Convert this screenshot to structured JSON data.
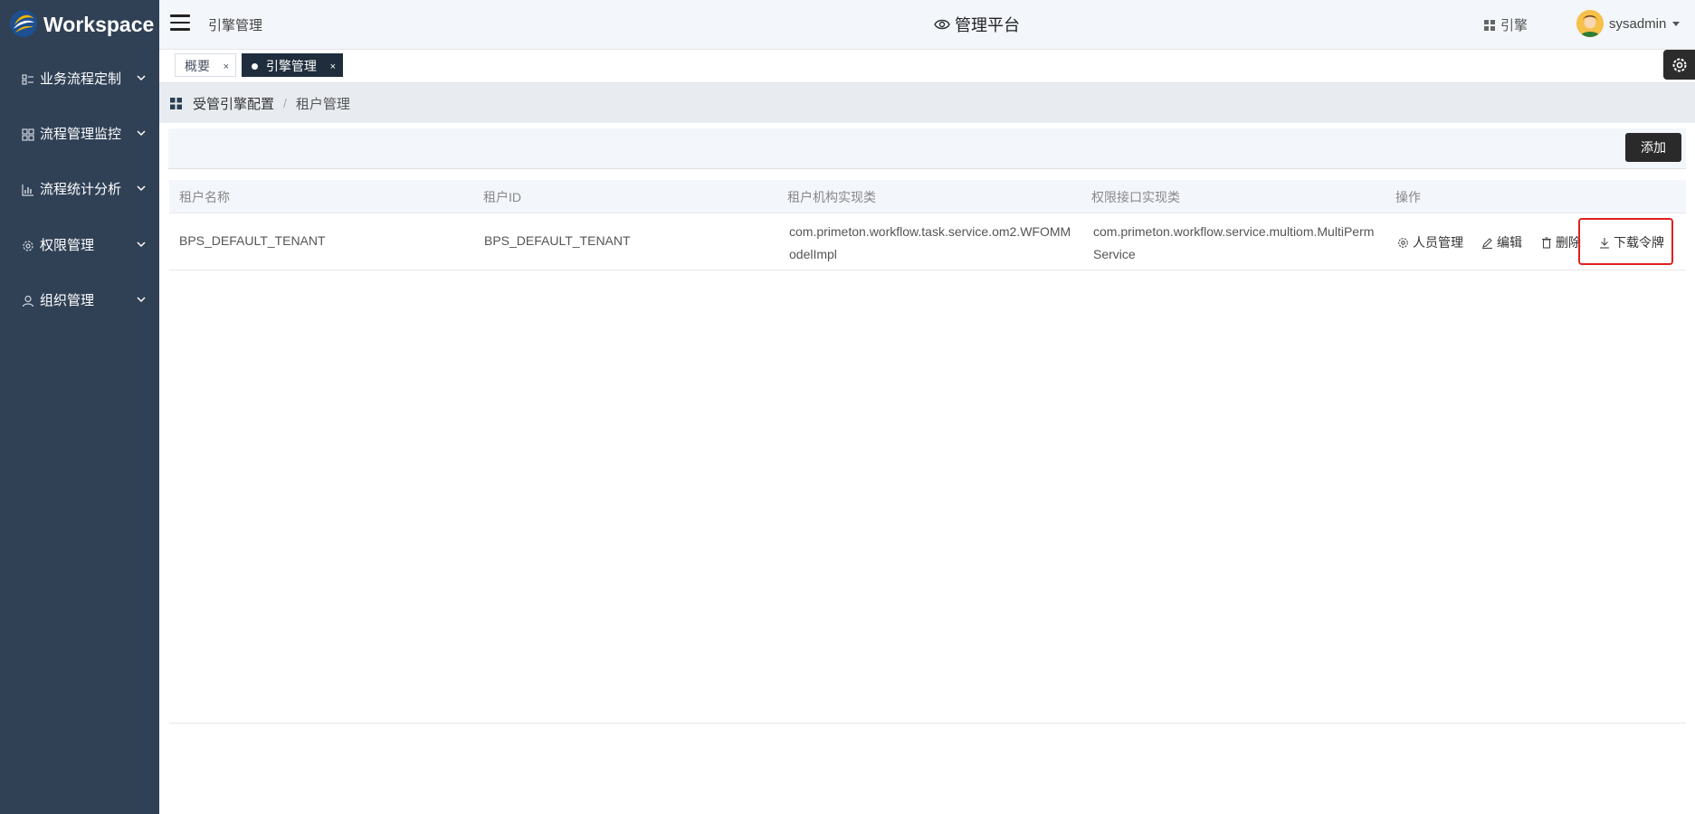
{
  "app": {
    "logo_text": "Workspace"
  },
  "sidebar": {
    "items": [
      {
        "label": "业务流程定制",
        "icon": "list-icon"
      },
      {
        "label": "流程管理监控",
        "icon": "grid-icon"
      },
      {
        "label": "流程统计分析",
        "icon": "bar-chart-icon"
      },
      {
        "label": "权限管理",
        "icon": "gear-icon"
      },
      {
        "label": "组织管理",
        "icon": "user-icon"
      }
    ]
  },
  "header": {
    "title": "引擎管理",
    "center_title": "管理平台",
    "engine_link": "引擎",
    "username": "sysadmin"
  },
  "tabs": [
    {
      "label": "概要",
      "active": false
    },
    {
      "label": "引擎管理",
      "active": true
    }
  ],
  "breadcrumb": {
    "parent": "受管引擎配置",
    "separator": "/",
    "current": "租户管理"
  },
  "toolbar": {
    "add_label": "添加"
  },
  "table": {
    "headers": [
      "租户名称",
      "租户ID",
      "租户机构实现类",
      "权限接口实现类",
      "操作"
    ],
    "rows": [
      {
        "name": "BPS_DEFAULT_TENANT",
        "id": "BPS_DEFAULT_TENANT",
        "org_impl": "com.primeton.workflow.task.service.om2.WFOMModelImpl",
        "perm_impl": "com.primeton.workflow.service.multiom.MultiPermService"
      }
    ],
    "actions": [
      "人员管理",
      "编辑",
      "删除",
      "下载令牌"
    ]
  },
  "colors": {
    "sidebar_bg": "#304156",
    "highlight": "#e02020",
    "active_tab": "#1f2d3d"
  }
}
